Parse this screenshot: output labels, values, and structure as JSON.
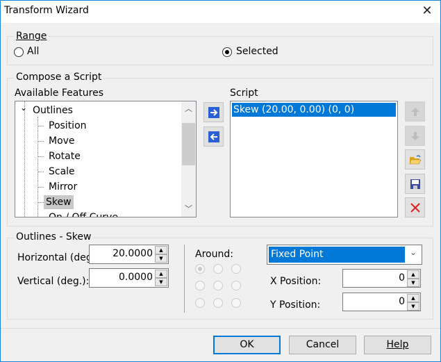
{
  "window": {
    "title": "Transform Wizard",
    "close_icon": "close-icon"
  },
  "range": {
    "label": "Range",
    "options": [
      {
        "label": "All",
        "selected": false
      },
      {
        "label": "Selected",
        "selected": true
      }
    ]
  },
  "compose": {
    "label": "Compose a Script",
    "available_label": "Available Features",
    "script_label": "Script",
    "tree": {
      "root": "Outlines",
      "items": [
        "Position",
        "Move",
        "Rotate",
        "Scale",
        "Mirror",
        "Skew",
        "On / Off Curve"
      ],
      "selected": "Skew"
    },
    "script_items": [
      "Skew (20.00, 0.00) (0, 0)"
    ],
    "buttons": {
      "add": "arrow-right-icon",
      "remove": "arrow-left-icon",
      "up": "arrow-up-icon",
      "down": "arrow-down-icon",
      "open": "folder-open-icon",
      "save": "floppy-disk-icon",
      "delete": "red-x-icon"
    }
  },
  "skew": {
    "label": "Outlines - Skew",
    "horizontal_label": "Horizontal (deg.):",
    "horizontal_value": "20.0000",
    "vertical_label": "Vertical (deg.):",
    "vertical_value": "0.0000",
    "around_label": "Around:",
    "around_value": "Fixed Point",
    "x_label": "X Position:",
    "x_value": "0",
    "y_label": "Y Position:",
    "y_value": "0"
  },
  "footer": {
    "ok": "OK",
    "cancel": "Cancel",
    "help": "Help"
  },
  "colors": {
    "accent": "#0078d7",
    "window_border": "#1883d7"
  }
}
